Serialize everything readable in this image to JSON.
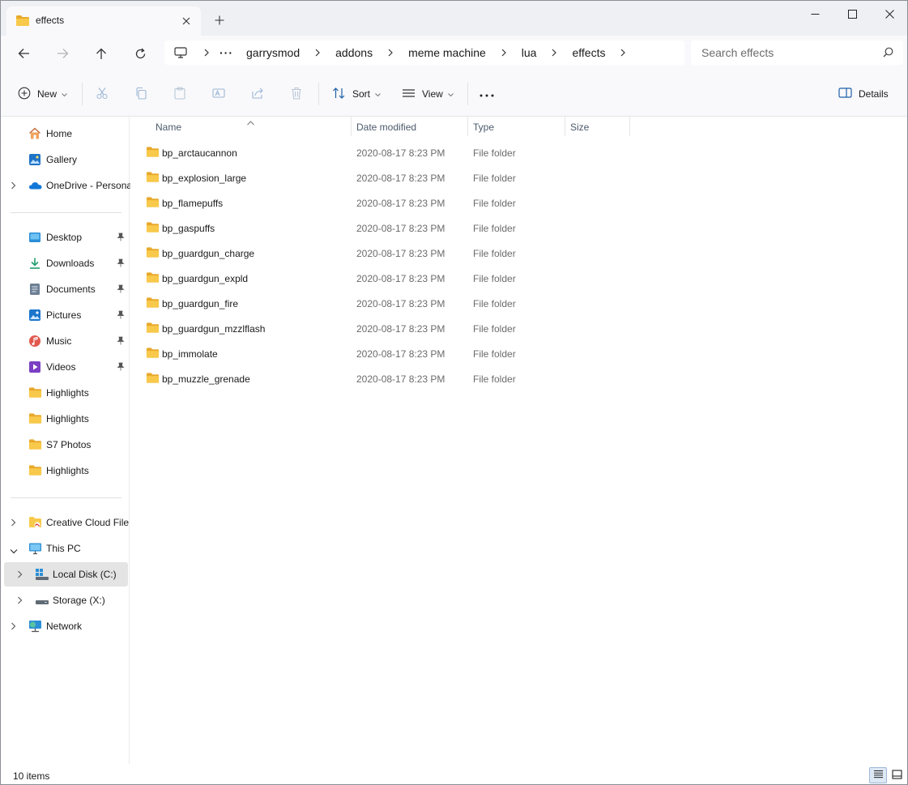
{
  "window": {
    "tab_title": "effects",
    "new_tab_symbol": "+"
  },
  "nav": {
    "breadcrumbs": [
      "garrysmod",
      "addons",
      "meme machine",
      "lua",
      "effects"
    ],
    "overflow_symbol": "···",
    "search_placeholder": "Search effects"
  },
  "command_bar": {
    "new_label": "New",
    "sort_label": "Sort",
    "view_label": "View",
    "details_label": "Details"
  },
  "sidebar": {
    "top": [
      {
        "label": "Home",
        "icon": "home-icon"
      },
      {
        "label": "Gallery",
        "icon": "gallery-icon"
      },
      {
        "label": "OneDrive - Persona",
        "icon": "onedrive-icon",
        "expandable": true
      }
    ],
    "quick_access": [
      {
        "label": "Desktop",
        "icon": "desktop-icon",
        "pinned": true
      },
      {
        "label": "Downloads",
        "icon": "downloads-icon",
        "pinned": true
      },
      {
        "label": "Documents",
        "icon": "documents-icon",
        "pinned": true
      },
      {
        "label": "Pictures",
        "icon": "pictures-icon",
        "pinned": true
      },
      {
        "label": "Music",
        "icon": "music-icon",
        "pinned": true
      },
      {
        "label": "Videos",
        "icon": "videos-icon",
        "pinned": true
      },
      {
        "label": "Highlights",
        "icon": "folder-icon",
        "pinned": false
      },
      {
        "label": "Highlights",
        "icon": "folder-icon",
        "pinned": false
      },
      {
        "label": "S7 Photos",
        "icon": "folder-icon",
        "pinned": false
      },
      {
        "label": "Highlights",
        "icon": "folder-icon",
        "pinned": false
      }
    ],
    "drives": [
      {
        "label": "Creative Cloud Files",
        "icon": "creative-cloud-icon",
        "chevron": "right"
      },
      {
        "label": "This PC",
        "icon": "this-pc-icon",
        "chevron": "down"
      },
      {
        "label": "Local Disk (C:)",
        "icon": "local-disk-icon",
        "chevron": "right",
        "selected": true
      },
      {
        "label": "Storage (X:)",
        "icon": "storage-drive-icon",
        "chevron": "right"
      },
      {
        "label": "Network",
        "icon": "network-icon",
        "chevron": "right"
      }
    ]
  },
  "columns": {
    "name": "Name",
    "date": "Date modified",
    "type": "Type",
    "size": "Size"
  },
  "files": [
    {
      "name": "bp_arctaucannon",
      "date": "2020-08-17 8:23 PM",
      "type": "File folder",
      "size": ""
    },
    {
      "name": "bp_explosion_large",
      "date": "2020-08-17 8:23 PM",
      "type": "File folder",
      "size": ""
    },
    {
      "name": "bp_flamepuffs",
      "date": "2020-08-17 8:23 PM",
      "type": "File folder",
      "size": ""
    },
    {
      "name": "bp_gaspuffs",
      "date": "2020-08-17 8:23 PM",
      "type": "File folder",
      "size": ""
    },
    {
      "name": "bp_guardgun_charge",
      "date": "2020-08-17 8:23 PM",
      "type": "File folder",
      "size": ""
    },
    {
      "name": "bp_guardgun_expld",
      "date": "2020-08-17 8:23 PM",
      "type": "File folder",
      "size": ""
    },
    {
      "name": "bp_guardgun_fire",
      "date": "2020-08-17 8:23 PM",
      "type": "File folder",
      "size": ""
    },
    {
      "name": "bp_guardgun_mzzlflash",
      "date": "2020-08-17 8:23 PM",
      "type": "File folder",
      "size": ""
    },
    {
      "name": "bp_immolate",
      "date": "2020-08-17 8:23 PM",
      "type": "File folder",
      "size": ""
    },
    {
      "name": "bp_muzzle_grenade",
      "date": "2020-08-17 8:23 PM",
      "type": "File folder",
      "size": ""
    }
  ],
  "status": {
    "item_count": "10 items"
  },
  "colors": {
    "folder_yellow": "#f8c94a",
    "folder_dark": "#e8a92b",
    "accent": "#0067c0",
    "selected_bg": "#e4e4e4"
  }
}
